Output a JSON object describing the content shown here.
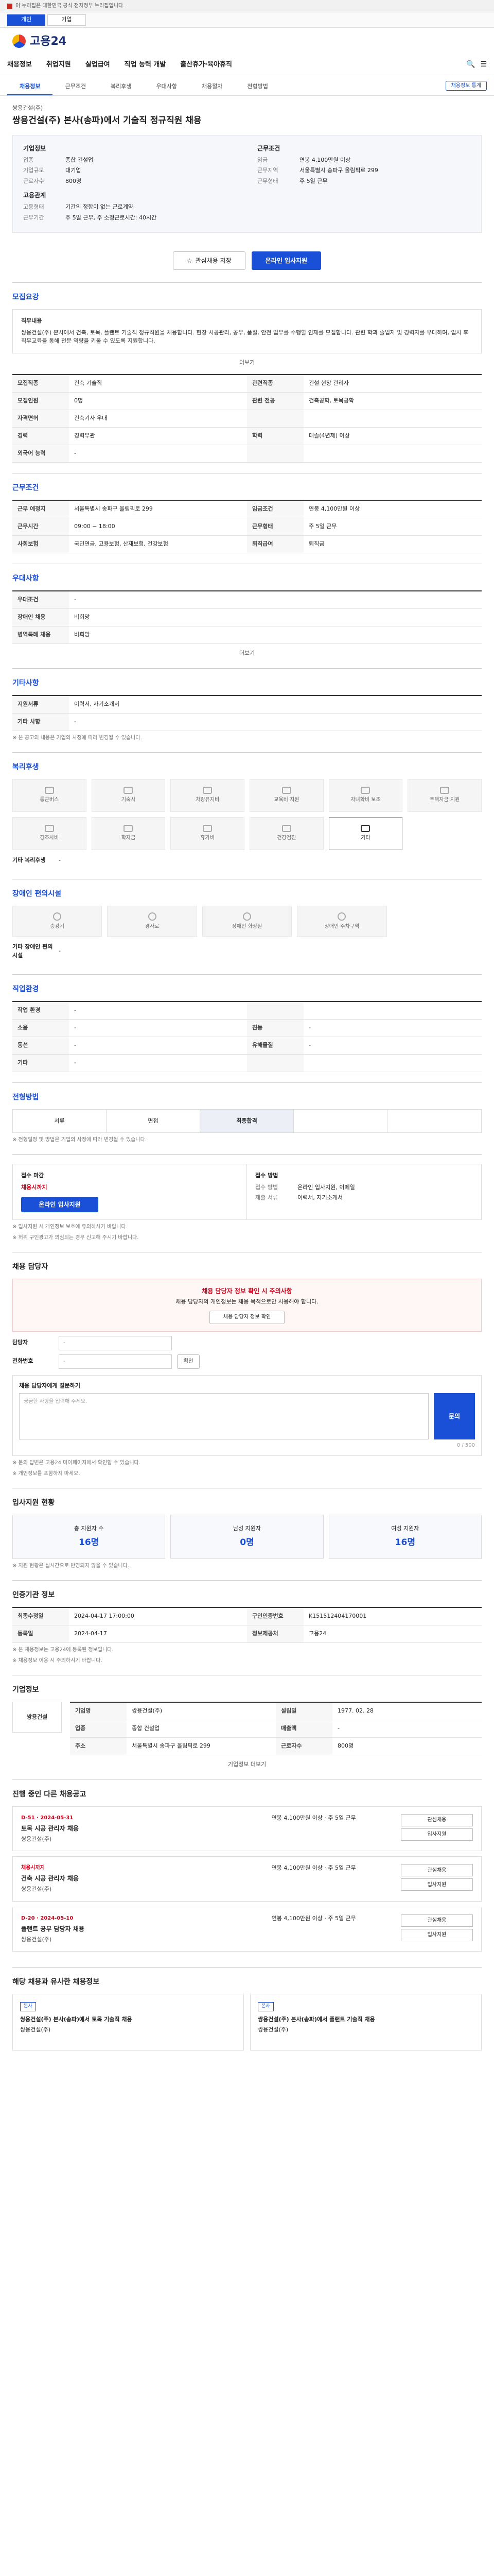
{
  "topbar": {
    "text": "이 누리집은 대한민국 공식 전자정부 누리집입니다."
  },
  "subbar": {
    "tabs": [
      "개인",
      "기업"
    ]
  },
  "header": {
    "logo": "고용24"
  },
  "gnb": {
    "items": [
      "채용정보",
      "취업지원",
      "실업급여",
      "직업 능력 개발",
      "출산휴가·육아휴직"
    ]
  },
  "subtabs": {
    "items": [
      "채용정보",
      "근무조건",
      "복리후생",
      "우대사항",
      "채용절차",
      "전형방법"
    ],
    "btn": "채용정보 통계"
  },
  "job": {
    "company": "쌍용건설(주)",
    "title": "쌍용건설(주) 본사(송파)에서 기술직 정규직원 채용",
    "sum_left_title": "기업정보",
    "sum_right_title": "근무조건",
    "left": [
      {
        "k": "업종",
        "v": "종합 건설업"
      },
      {
        "k": "기업규모",
        "v": "대기업"
      },
      {
        "k": "근로자수",
        "v": "800명"
      }
    ],
    "right": [
      {
        "k": "임금",
        "v": "연봉 4,100만원 이상"
      },
      {
        "k": "근무지역",
        "v": "서울특별시 송파구 올림픽로 299"
      },
      {
        "k": "근무형태",
        "v": "주 5일 근무"
      }
    ],
    "contact_title": "고용관계",
    "contact": [
      {
        "k": "고용형태",
        "v": "기간의 정함이 없는 근로계약"
      },
      {
        "k": "근무기간",
        "v": "주 5일 근무, 주 소정근로시간: 40시간"
      }
    ]
  },
  "actions": {
    "scrap": "관심채용 저장",
    "apply": "온라인 입사지원"
  },
  "sec_info": {
    "title": "모집요강",
    "duty_title": "직무내용",
    "duty_text": "쌍용건설(주) 본사에서 건축, 토목, 플랜트 기술직 정규직원을 채용합니다. 현장 시공관리, 공무, 품질, 안전 업무를 수행할 인재를 모집합니다. 관련 학과 졸업자 및 경력자를 우대하며, 입사 후 직무교육을 통해 전문 역량을 키울 수 있도록 지원합니다.",
    "more": "더보기",
    "rows": [
      [
        "모집직종",
        "건축 기술직",
        "관련직종",
        "건설 현장 관리자"
      ],
      [
        "모집인원",
        "0명",
        "관련 전공",
        "건축공학, 토목공학"
      ],
      [
        "자격면허",
        "건축기사 우대",
        "",
        ""
      ],
      [
        "경력",
        "경력무관",
        "학력",
        "대졸(4년제) 이상"
      ],
      [
        "외국어 능력",
        "-",
        "",
        ""
      ]
    ]
  },
  "sec_cond": {
    "title": "근무조건",
    "rows": [
      [
        "근무 예정지",
        "서울특별시 송파구 올림픽로 299",
        "임금조건",
        "연봉 4,100만원 이상"
      ],
      [
        "근무시간",
        "09:00 ~ 18:00",
        "근무형태",
        "주 5일 근무"
      ],
      [
        "사회보험",
        "국민연금, 고용보험, 산재보험, 건강보험",
        "퇴직급여",
        "퇴직금"
      ]
    ]
  },
  "sec_welfare": {
    "title": "우대사항",
    "rows": [
      [
        "우대조건",
        "-"
      ],
      [
        "장애인 채용",
        "비희망"
      ],
      [
        "병역특례 채용",
        "비희망"
      ]
    ],
    "more": "더보기"
  },
  "sec_etc": {
    "title": "기타사항",
    "rows": [
      [
        "지원서류",
        "이력서, 자기소개서"
      ],
      [
        "기타 사항",
        "-"
      ]
    ],
    "note": "※ 본 공고의 내용은 기업의 사정에 따라 변경될 수 있습니다."
  },
  "sec_benefit": {
    "title": "복리후생",
    "items": [
      "통근버스",
      "기숙사",
      "차량유지비",
      "교육비 지원",
      "자녀학비 보조",
      "주택자금 지원",
      "경조사비",
      "학자금",
      "휴가비",
      "건강검진",
      "기타"
    ],
    "note": "기타 복리후생",
    "note_val": "-"
  },
  "sec_disabled": {
    "title": "장애인 편의시설",
    "items": [
      "승강기",
      "경사로",
      "장애인 화장실",
      "장애인 주차구역"
    ],
    "note": "기타 장애인 편의시설",
    "note_val": "-"
  },
  "sec_field": {
    "title": "직업환경",
    "rows": [
      [
        "작업 환경",
        "-",
        "",
        ""
      ],
      [
        "소음",
        "-",
        "진동",
        "-"
      ],
      [
        "동선",
        "-",
        "유해물질",
        "-"
      ],
      [
        "기타",
        "-",
        "",
        ""
      ]
    ]
  },
  "sec_process": {
    "title": "전형방법",
    "steps": [
      "서류",
      "면접",
      "최종합격",
      "",
      ""
    ],
    "note": "※ 전형일정 및 방법은 기업의 사정에 따라 변경될 수 있습니다."
  },
  "sec_apply": {
    "title_left": "접수 마감",
    "deadline": "채용시까지",
    "apply_btn": "온라인 입사지원",
    "title_right": "접수 방법",
    "method_lb": "접수 방법",
    "method": "온라인 입사지원, 이메일",
    "docs_lb": "제출 서류",
    "docs": "이력서, 자기소개서",
    "notes": [
      "※ 입사지원 시 개인정보 보호에 유의하시기 바랍니다.",
      "※ 허위 구인광고가 의심되는 경우 신고해 주시기 바랍니다."
    ]
  },
  "sec_inquiry": {
    "title": "채용 담당자",
    "alert_title": "채용 담당자 정보 확인 시 주의사항",
    "alert_text": "채용 담당자의 개인정보는 채용 목적으로만 사용해야 합니다.",
    "alert_btn": "채용 담당자 정보 확인",
    "lb_name": "담당자",
    "name_ph": "-",
    "lb_phone": "전화번호",
    "phone_ph": "-",
    "phone_btn": "확인",
    "msg_title": "채용 담당자에게 질문하기",
    "msg_ph": "궁금한 사항을 입력해 주세요.",
    "count": "0 / 500",
    "send": "문의",
    "notes": [
      "※ 문의 답변은 고용24 마이페이지에서 확인할 수 있습니다.",
      "※ 개인정보를 포함하지 마세요."
    ]
  },
  "sec_stats": {
    "title": "입사지원 현황",
    "items": [
      {
        "lb": "총 지원자 수",
        "v": "16명"
      },
      {
        "lb": "남성 지원자",
        "v": "0명"
      },
      {
        "lb": "여성 지원자",
        "v": "16명"
      }
    ],
    "note": "※ 지원 현황은 실시간으로 반영되지 않을 수 있습니다."
  },
  "sec_info2": {
    "title": "인증기관 정보",
    "rows": [
      [
        "최종수정일",
        "2024-04-17 17:00:00",
        "구인인증번호",
        "K151512404170001"
      ],
      [
        "등록일",
        "2024-04-17",
        "정보제공처",
        "고용24"
      ]
    ],
    "notes": [
      "※ 본 채용정보는 고용24에 등록된 정보입니다.",
      "※ 채용정보 이용 시 주의하시기 바랍니다."
    ]
  },
  "sec_corp": {
    "title": "기업정보",
    "logo": "쌍용건설",
    "rows": [
      [
        "기업명",
        "쌍용건설(주)",
        "설립일",
        "1977. 02. 28"
      ],
      [
        "업종",
        "종합 건설업",
        "매출액",
        "-"
      ],
      [
        "주소",
        "서울특별시 송파구 올림픽로 299",
        "근로자수",
        "800명"
      ]
    ],
    "more": "기업정보 더보기"
  },
  "sec_jobs": {
    "title": "진행 중인 다른 채용공고",
    "cards": [
      {
        "tag": "D-51 · 2024-05-31",
        "title": "토목 시공 관리자 채용",
        "cmp": "쌍용건설(주)",
        "cond": "연봉 4,100만원 이상 · 주 5일 근무",
        "b1": "관심채용",
        "b2": "입사지원"
      },
      {
        "tag": "채용시까지",
        "title": "건축 시공 관리자 채용",
        "cmp": "쌍용건설(주)",
        "cond": "연봉 4,100만원 이상 · 주 5일 근무",
        "b1": "관심채용",
        "b2": "입사지원"
      },
      {
        "tag": "D-20 · 2024-05-10",
        "title": "플랜트 공무 담당자 채용",
        "cmp": "쌍용건설(주)",
        "cond": "연봉 4,100만원 이상 · 주 5일 근무",
        "b1": "관심채용",
        "b2": "입사지원"
      }
    ]
  },
  "sec_sim": {
    "title": "해당 채용과 유사한 채용정보",
    "cards": [
      {
        "badge": "본사",
        "title": "쌍용건설(주) 본사(송파)에서 토목 기술직 채용",
        "cmp": "쌍용건설(주)"
      },
      {
        "badge": "본사",
        "title": "쌍용건설(주) 본사(송파)에서 플랜트 기술직 채용",
        "cmp": "쌍용건설(주)"
      }
    ]
  }
}
